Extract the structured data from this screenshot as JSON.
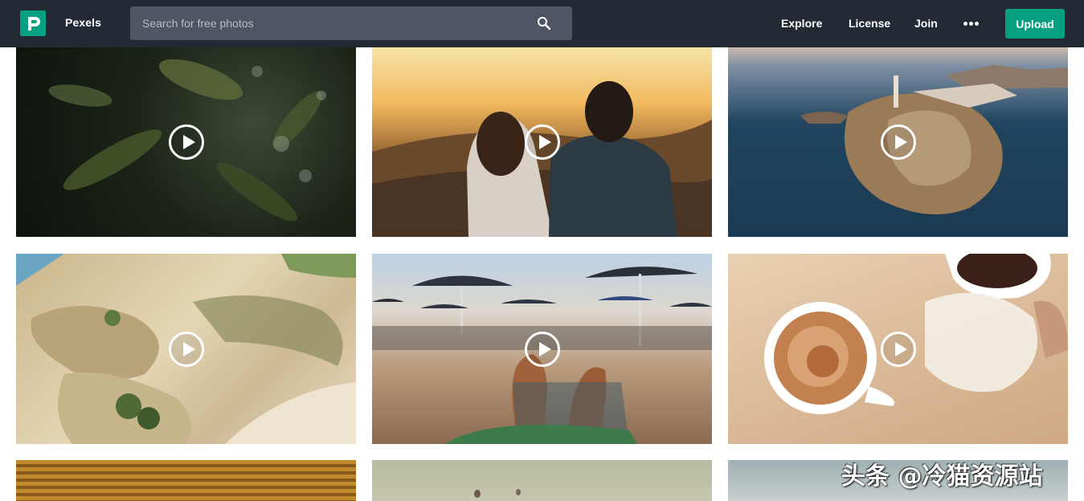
{
  "header": {
    "brand": "Pexels",
    "search_placeholder": "Search for free photos",
    "nav": {
      "explore": "Explore",
      "license": "License",
      "join": "Join"
    },
    "upload_label": "Upload",
    "colors": {
      "bar": "#232a34",
      "accent": "#05a081",
      "search": "#4f5563"
    }
  },
  "videos": [
    {
      "subject": "leaves",
      "icon": "play-icon"
    },
    {
      "subject": "couple-sunset",
      "icon": "play-icon"
    },
    {
      "subject": "coastal-island",
      "icon": "play-icon"
    },
    {
      "subject": "sand-dunes",
      "icon": "play-icon"
    },
    {
      "subject": "beach-umbrellas",
      "icon": "play-icon"
    },
    {
      "subject": "coffee-pour",
      "icon": "play-icon"
    }
  ],
  "watermark": "头条 @冷猫资源站"
}
